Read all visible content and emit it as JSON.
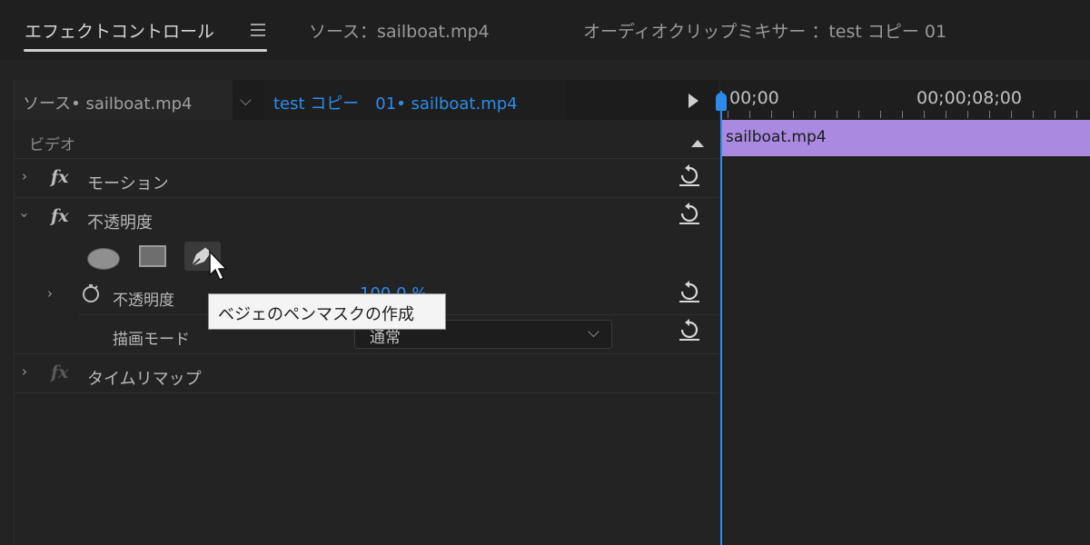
{
  "tabs": [
    {
      "label": "エフェクトコントロール",
      "active": true
    },
    {
      "label": "ソース：sailboat.mp4",
      "active": false
    },
    {
      "label": "オーディオクリップミキサー ：test コピー 01",
      "active": false
    }
  ],
  "source_bar": {
    "source": "ソース• sailboat.mp4",
    "sequence": "test コピー　01• sailboat.mp4"
  },
  "section": {
    "label": "ビデオ"
  },
  "effects": [
    {
      "label": "モーション"
    },
    {
      "label": "不透明度"
    },
    {
      "label": "タイムリマップ"
    }
  ],
  "opacity": {
    "property_label": "不透明度",
    "value": "100.0 %",
    "blend_label": "描画モード",
    "blend_value": "通常"
  },
  "tooltip": "ベジェのペンマスクの作成",
  "timeline": {
    "timecodes": [
      "00;00",
      "00;00;08;00"
    ],
    "clip_label": "sailboat.mp4"
  },
  "colors": {
    "accent": "#2d8ceb",
    "clip": "#a98ae0"
  }
}
